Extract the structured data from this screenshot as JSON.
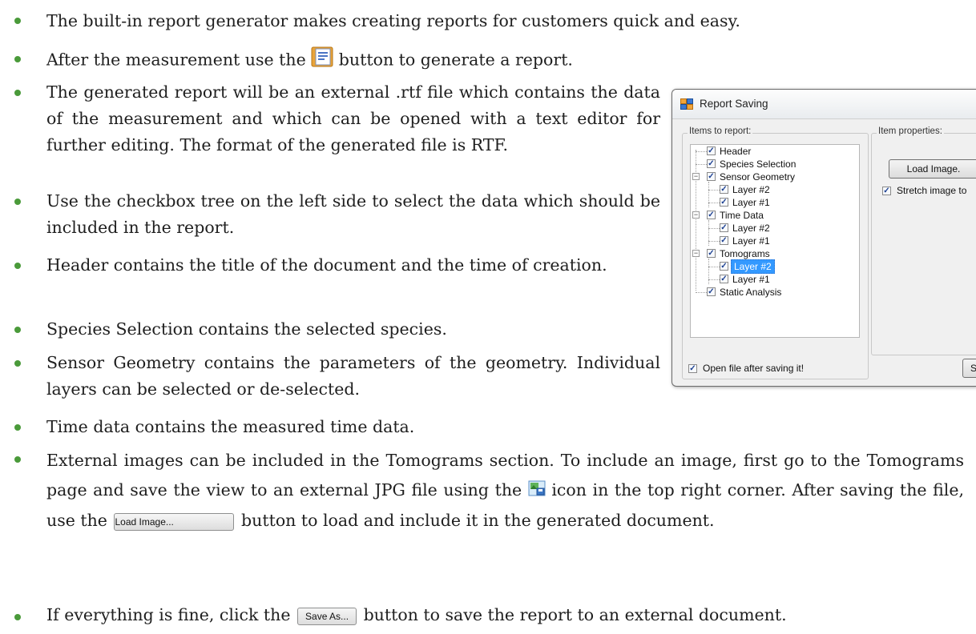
{
  "bullets": [
    "The built-in report generator makes creating reports for customers quick and easy.",
    {
      "before": "After the measurement use the",
      "after": "button to generate a report."
    },
    "The generated report will be an external .rtf file which contains the data of the measurement and which can be opened with a text editor for further editing. The format of the generated file is RTF.",
    "Use the checkbox tree on the left side to select the data which should be included in the report.",
    "Header contains the title of the document and the time of creation.",
    "Species Selection contains the selected species.",
    "Sensor Geometry contains the parameters of the geometry. Individual layers can be selected or de-selected.",
    "Time data contains the measured time data.",
    {
      "part1": "External images can be included in the Tomograms section. To include an image, first go to the Tomograms page and save the view to an external JPG file using the",
      "part2": "icon in the top right corner. After saving the file, use the",
      "part3": "button to load and include it in the generated document."
    },
    {
      "before": "If everything is fine, click the",
      "after": "button to save the report to an external document."
    }
  ],
  "inline_buttons": {
    "load_image": "Load Image...",
    "save_as": "Save As..."
  },
  "dialog": {
    "title": "Report Saving",
    "items_group_label": "Items to report:",
    "properties_group_label": "Item properties:",
    "load_image_button": "Load Image.",
    "stretch_checkbox_label": "Stretch image to",
    "open_file_checkbox_label": "Open file after saving it!",
    "save_button_partial": "S",
    "tree": [
      {
        "label": "Header",
        "checked": true
      },
      {
        "label": "Species Selection",
        "checked": true
      },
      {
        "label": "Sensor Geometry",
        "checked": true
      },
      {
        "label": "Layer #2",
        "checked": true
      },
      {
        "label": "Layer #1",
        "checked": true
      },
      {
        "label": "Time Data",
        "checked": true
      },
      {
        "label": "Layer #2",
        "checked": true
      },
      {
        "label": "Layer #1",
        "checked": true
      },
      {
        "label": "Tomograms",
        "checked": true
      },
      {
        "label": "Layer #2",
        "checked": true,
        "selected": true
      },
      {
        "label": "Layer #1",
        "checked": true
      },
      {
        "label": "Static Analysis",
        "checked": true
      }
    ]
  },
  "colors": {
    "bullet": "#4a9a3a",
    "selection": "#3399ff"
  },
  "icons": [
    "report-icon",
    "save-image-icon",
    "window-icon"
  ]
}
